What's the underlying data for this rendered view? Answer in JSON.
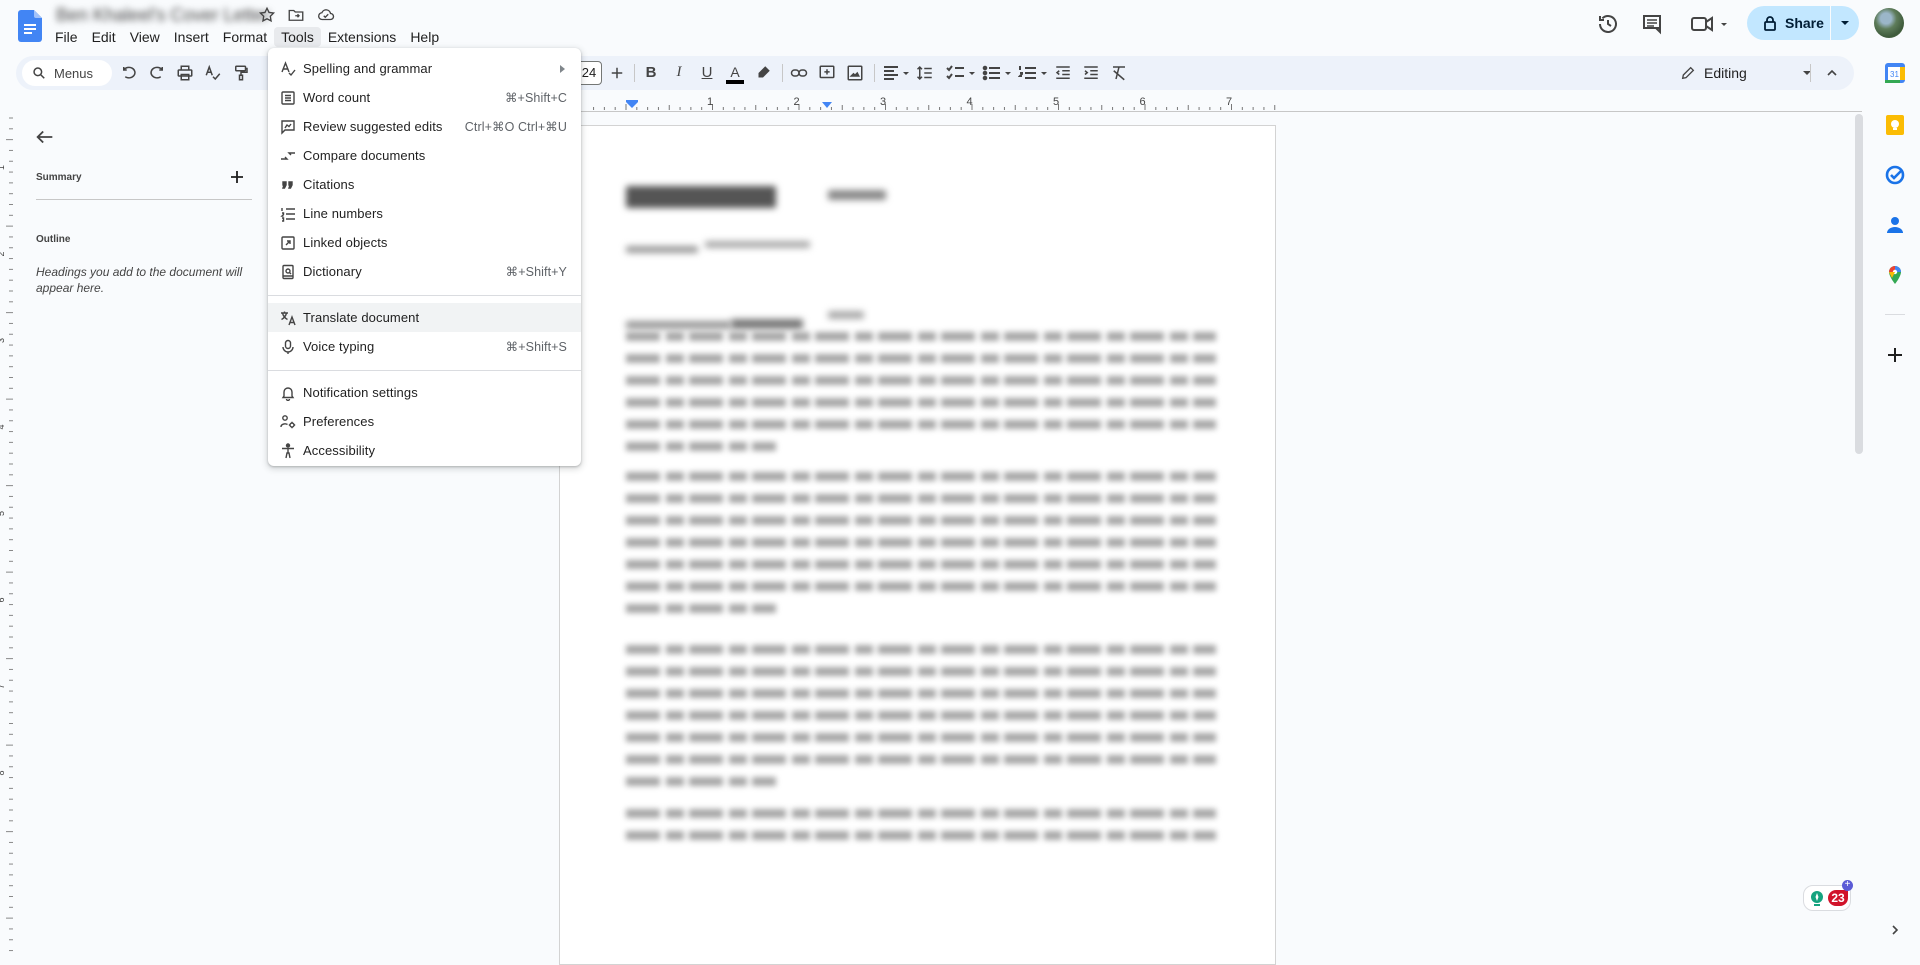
{
  "document": {
    "title": "Ben Khaleel's Cover Letter"
  },
  "menubar": {
    "items": [
      "File",
      "Edit",
      "View",
      "Insert",
      "Format",
      "Tools",
      "Extensions",
      "Help"
    ],
    "active": "Tools"
  },
  "header": {
    "share_label": "Share"
  },
  "toolbar": {
    "search_label": "Menus",
    "font_size": "24",
    "mode_label": "Editing"
  },
  "ruler": {
    "h_labels": [
      "1",
      "2",
      "3",
      "4",
      "5",
      "6",
      "7"
    ],
    "v_labels": [
      "1",
      "2",
      "3",
      "4",
      "5",
      "6",
      "7",
      "8"
    ]
  },
  "outline_panel": {
    "summary_label": "Summary",
    "outline_label": "Outline",
    "empty_text": "Headings you add to the document will appear here."
  },
  "tools_menu": {
    "groups": [
      [
        {
          "label": "Spelling and grammar",
          "icon": "spellcheck-icon",
          "submenu": true,
          "shortcut": ""
        },
        {
          "label": "Word count",
          "icon": "word-count-icon",
          "shortcut": "⌘+Shift+C"
        },
        {
          "label": "Review suggested edits",
          "icon": "review-edits-icon",
          "shortcut": "Ctrl+⌘O Ctrl+⌘U"
        },
        {
          "label": "Compare documents",
          "icon": "compare-icon",
          "shortcut": ""
        },
        {
          "label": "Citations",
          "icon": "quote-icon",
          "shortcut": ""
        },
        {
          "label": "Line numbers",
          "icon": "line-numbers-icon",
          "shortcut": ""
        },
        {
          "label": "Linked objects",
          "icon": "linked-objects-icon",
          "shortcut": ""
        },
        {
          "label": "Dictionary",
          "icon": "dictionary-icon",
          "shortcut": "⌘+Shift+Y"
        }
      ],
      [
        {
          "label": "Translate document",
          "icon": "translate-icon",
          "shortcut": "",
          "highlighted": true
        },
        {
          "label": "Voice typing",
          "icon": "microphone-icon",
          "shortcut": "⌘+Shift+S"
        }
      ],
      [
        {
          "label": "Notification settings",
          "icon": "bell-icon",
          "shortcut": ""
        },
        {
          "label": "Preferences",
          "icon": "preferences-icon",
          "shortcut": ""
        },
        {
          "label": "Accessibility",
          "icon": "accessibility-icon",
          "shortcut": ""
        }
      ]
    ]
  },
  "side_panel": {
    "badge_count": "23"
  },
  "colors": {
    "accent": "#0b57d0",
    "share_bg": "#c2e7ff",
    "toolbar_bg": "#edf2fa",
    "menu_highlight": "#f1f3f4"
  }
}
